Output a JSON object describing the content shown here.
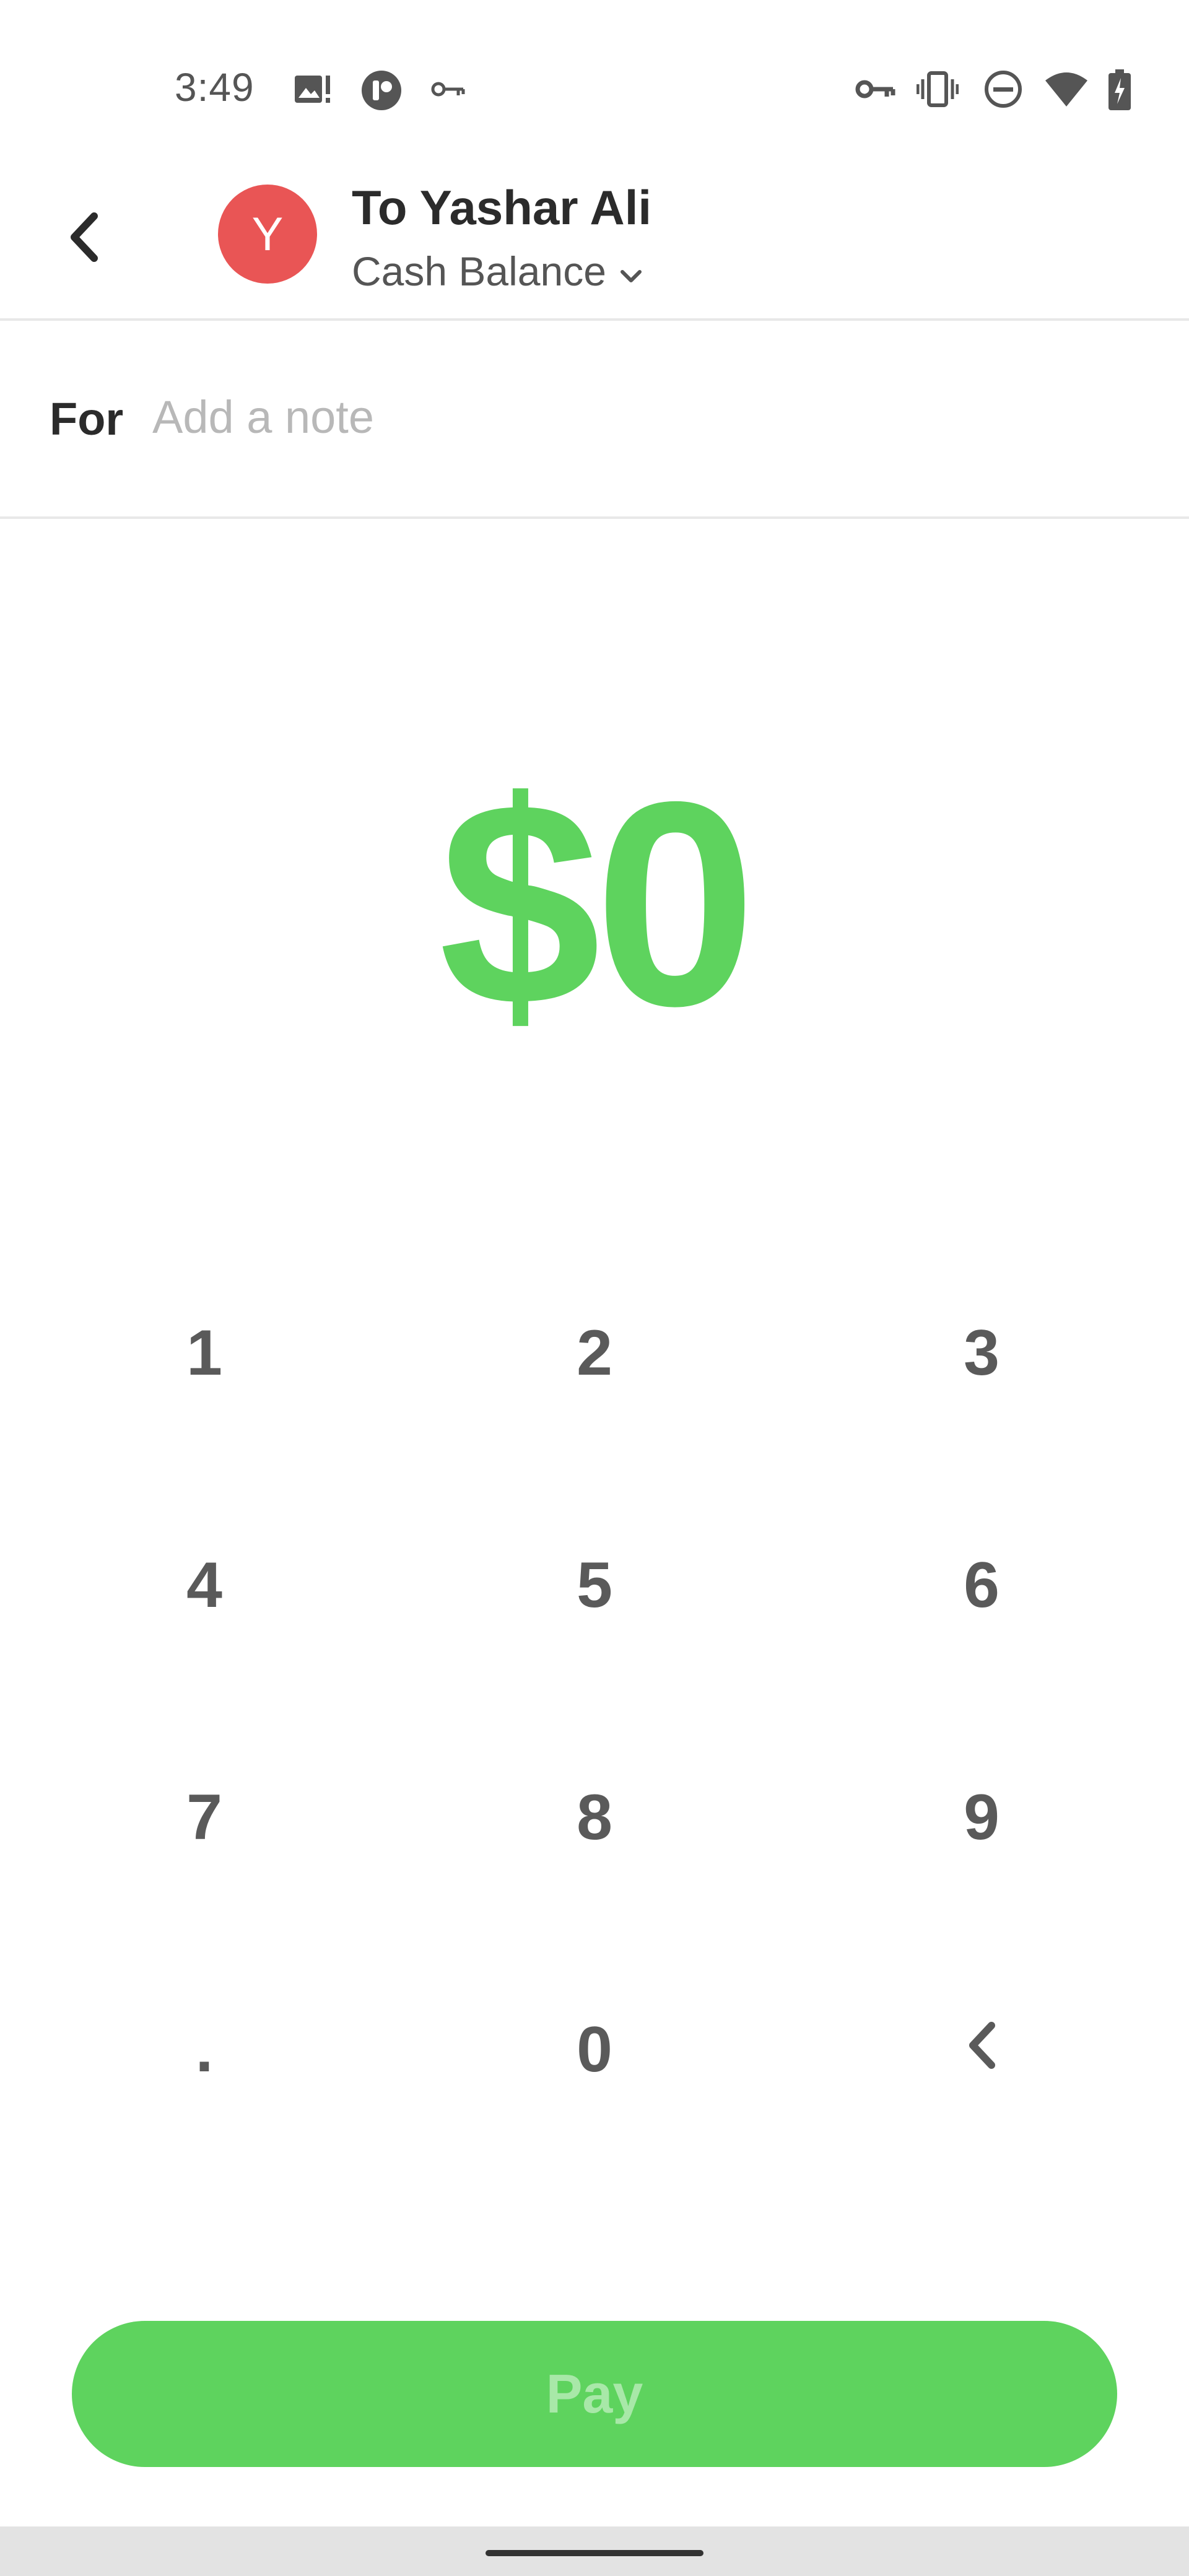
{
  "status_bar": {
    "time": "3:49",
    "left_icons": [
      "image-alert-icon",
      "app-notification-icon",
      "vpn-key-icon"
    ],
    "right_icons": [
      "vpn-key-icon",
      "vibrate-icon",
      "do-not-disturb-icon",
      "wifi-icon",
      "battery-charging-icon"
    ]
  },
  "header": {
    "back_icon": "chevron-left-icon",
    "avatar_initial": "Y",
    "avatar_color": "#e95555",
    "title": "To Yashar Ali",
    "payment_source": "Cash Balance",
    "dropdown_icon": "chevron-down-icon"
  },
  "note": {
    "label": "For",
    "value": "",
    "placeholder": "Add a note"
  },
  "amount": {
    "display": "$0",
    "color": "#5ed35e"
  },
  "keypad": {
    "keys": [
      "1",
      "2",
      "3",
      "4",
      "5",
      "6",
      "7",
      "8",
      "9",
      ".",
      "0"
    ],
    "backspace_icon": "backspace-chevron-icon"
  },
  "pay_button": {
    "label": "Pay",
    "enabled": false,
    "color": "#5ed35e"
  }
}
